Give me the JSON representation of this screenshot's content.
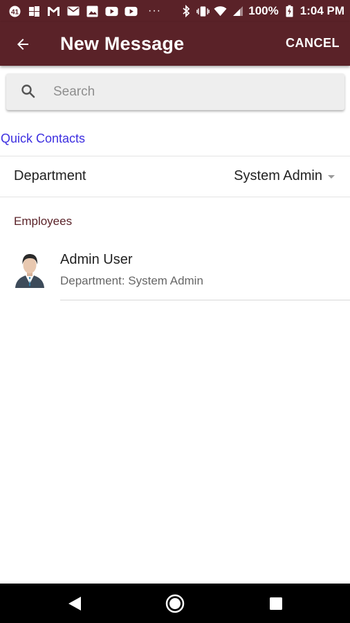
{
  "status_bar": {
    "battery": "100%",
    "time": "1:04 PM",
    "overflow": "···"
  },
  "app_bar": {
    "title": "New Message",
    "cancel_label": "CANCEL",
    "background_color": "#5a2228"
  },
  "search": {
    "placeholder": "Search",
    "value": ""
  },
  "quick_contacts": {
    "label": "Quick Contacts",
    "color": "#3d2fe0"
  },
  "department": {
    "label": "Department",
    "selected": "System Admin"
  },
  "employees": {
    "header": "Employees",
    "items": [
      {
        "name": "Admin User",
        "department": "Department: System Admin",
        "avatar_icon": "businessman-avatar-icon"
      }
    ]
  },
  "nav_bar": {
    "icons": [
      "back-triangle-icon",
      "home-circle-icon",
      "recents-square-icon"
    ]
  }
}
